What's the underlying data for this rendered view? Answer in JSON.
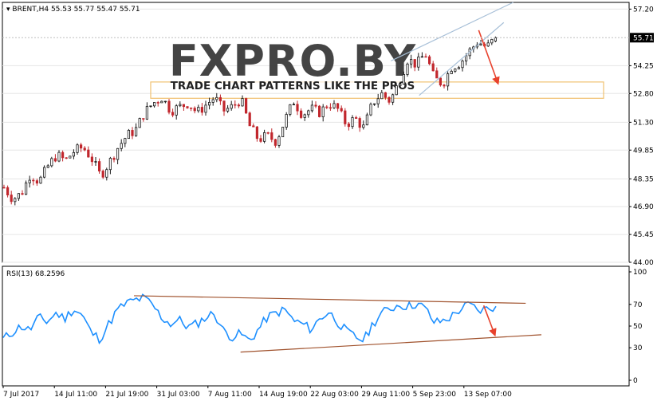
{
  "header": {
    "symbol_line": "BRENT,H4  55.53 55.77 55.47 55.71"
  },
  "watermark": {
    "brand": "FXPRO.BY",
    "tagline": "TRADE CHART PATTERNS LIKE THE PROS"
  },
  "colors": {
    "background": "#ffffff",
    "frame": "#000000",
    "candle_up": "#1a1a1a",
    "candle_down": "#c1272d",
    "rsi_line": "#1e90ff",
    "trend_line": "#a0522d",
    "wedge_line": "#a8c0d8",
    "zone_border": "#f0c070",
    "arrow": "#e8412c",
    "grid": "#e6e6e6",
    "current_price_line": "#c0c0c0",
    "label_bg": "#000000",
    "label_fg": "#ffffff"
  },
  "chart_data": [
    {
      "type": "candlestick",
      "symbol": "BRENT",
      "timeframe": "H4",
      "ohlc_last": {
        "open": 55.53,
        "high": 55.77,
        "low": 55.47,
        "close": 55.71
      },
      "y_ticks": [
        "57.20",
        "54.25",
        "52.80",
        "51.30",
        "49.85",
        "48.35",
        "46.90",
        "45.45",
        "44.00"
      ],
      "ylim": [
        44.0,
        57.55
      ],
      "current_price": 55.71,
      "current_price_label": "55.71",
      "trend_close": [
        47.9,
        47.3,
        47.6,
        48.6,
        48.2,
        49.0,
        49.6,
        49.3,
        49.8,
        50.0,
        49.4,
        48.5,
        49.2,
        50.0,
        50.6,
        50.9,
        51.8,
        52.3,
        52.6,
        51.9,
        52.1,
        52.3,
        51.8,
        52.2,
        52.6,
        51.9,
        52.1,
        52.5,
        51.1,
        50.4,
        50.6,
        50.3,
        51.4,
        52.4,
        51.7,
        52.0,
        51.8,
        52.3,
        52.0,
        51.2,
        51.5,
        51.0,
        52.3,
        52.8,
        52.4,
        53.4,
        54.6,
        54.3,
        54.9,
        53.6,
        53.3,
        54.2,
        54.4,
        55.0,
        55.5,
        55.2,
        55.71
      ],
      "sell_zone": [
        52.55,
        53.4
      ],
      "wedge": {
        "upper": {
          "from": [
            0.62,
            54.5
          ],
          "to": [
            0.815,
            57.55
          ]
        },
        "lower": {
          "from": [
            0.665,
            52.7
          ],
          "to": [
            0.8,
            56.5
          ]
        }
      },
      "projection": {
        "from": [
          0.76,
          56.1
        ],
        "to": [
          0.79,
          53.4
        ]
      }
    },
    {
      "type": "line",
      "name": "RSI(13)",
      "header": "RSI(13) 68.2596",
      "value_last": 68.2596,
      "y_ticks": [
        "100",
        "70",
        "50",
        "30",
        "0"
      ],
      "ylim": [
        0,
        100
      ],
      "trend": [
        38,
        44,
        50,
        46,
        58,
        54,
        62,
        57,
        66,
        60,
        44,
        38,
        52,
        65,
        71,
        74,
        76,
        69,
        58,
        52,
        56,
        49,
        52,
        58,
        62,
        46,
        40,
        43,
        36,
        47,
        58,
        62,
        65,
        55,
        52,
        47,
        57,
        63,
        54,
        45,
        40,
        37,
        52,
        62,
        66,
        70,
        68,
        71,
        66,
        53,
        55,
        59,
        66,
        70,
        64,
        66,
        68.26
      ],
      "resistance": {
        "from": [
          0.21,
          78
        ],
        "to": [
          0.835,
          71
        ]
      },
      "support": {
        "from": [
          0.38,
          26
        ],
        "to": [
          0.86,
          42
        ]
      },
      "projection": {
        "from": [
          0.768,
          69
        ],
        "to": [
          0.785,
          43
        ]
      }
    }
  ],
  "x_axis": {
    "labels": [
      "7 Jul 2017",
      "14 Jul 11:00",
      "21 Jul 19:00",
      "31 Jul 03:00",
      "7 Aug 11:00",
      "14 Aug 19:00",
      "22 Aug 03:00",
      "29 Aug 11:00",
      "5 Sep 23:00",
      "13 Sep 07:00"
    ]
  }
}
